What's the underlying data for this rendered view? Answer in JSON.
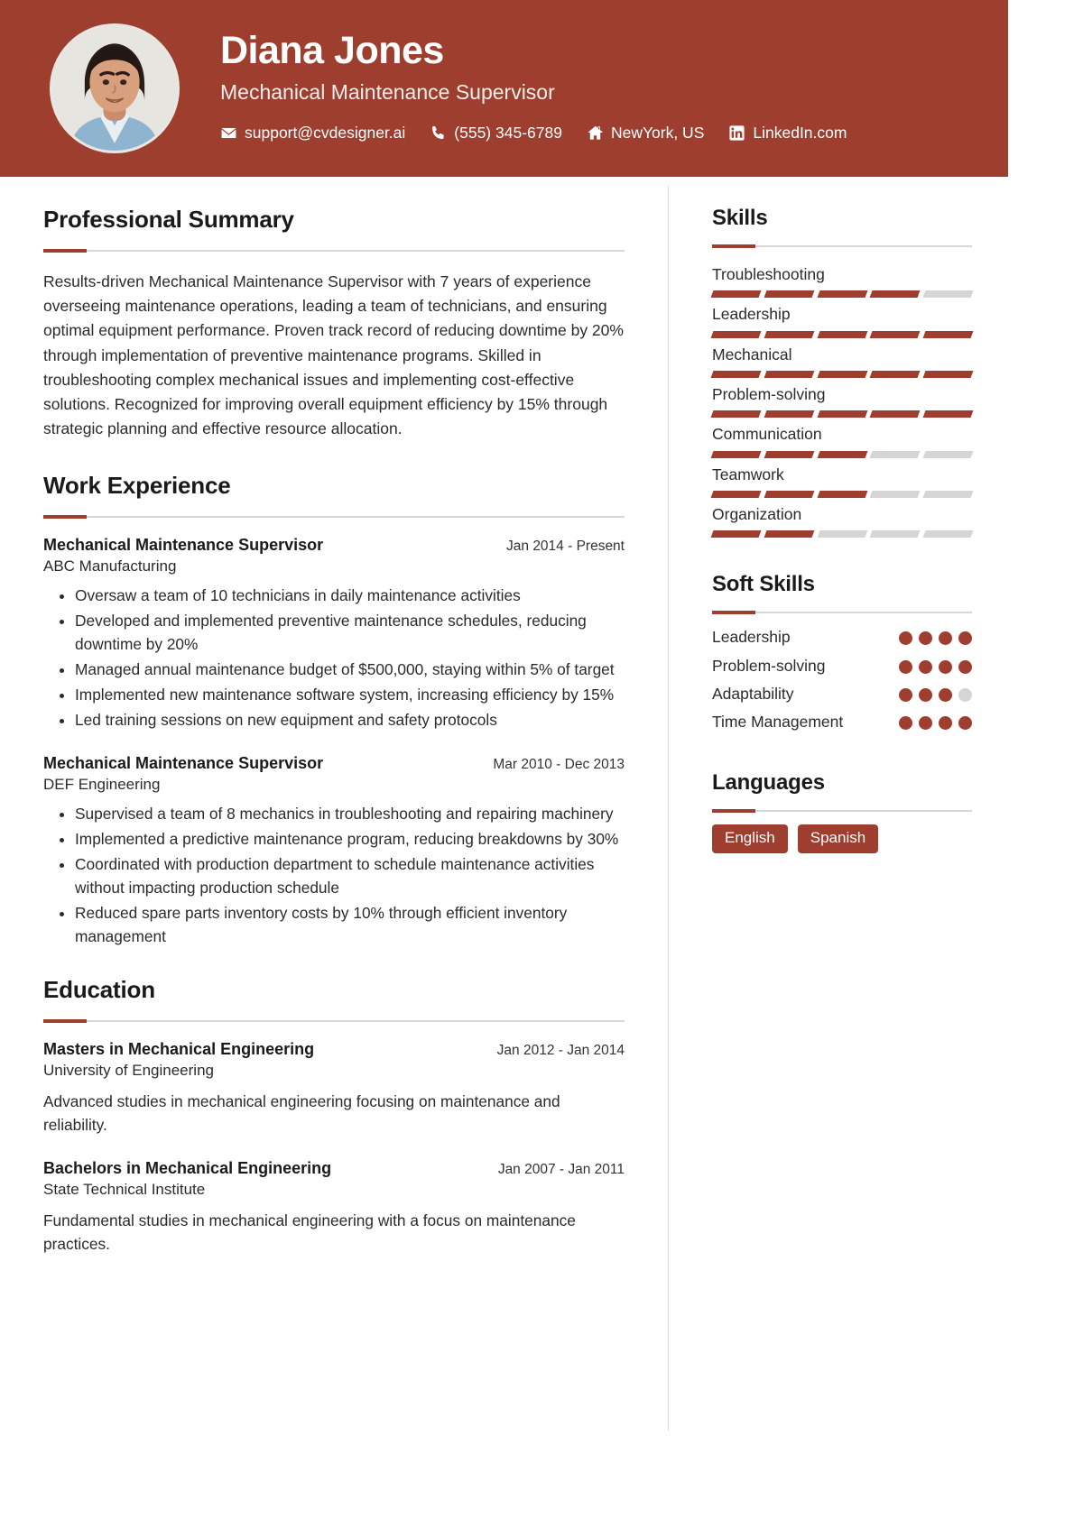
{
  "theme": {
    "accent": "#9E3E2F",
    "track": "#d5d5d5",
    "rule": "#d7d7d7",
    "text": "#2b2b2b"
  },
  "header": {
    "name": "Diana Jones",
    "job_title": "Mechanical Maintenance Supervisor",
    "avatar_alt": "profile-photo",
    "contacts": [
      {
        "icon": "envelope-icon",
        "text": "support@cvdesigner.ai"
      },
      {
        "icon": "phone-icon",
        "text": "(555) 345-6789"
      },
      {
        "icon": "home-icon",
        "text": "NewYork, US"
      },
      {
        "icon": "linkedin-icon",
        "text": "LinkedIn.com"
      }
    ]
  },
  "main": {
    "summary": {
      "title": "Professional Summary",
      "text": "Results-driven Mechanical Maintenance Supervisor with 7 years of experience overseeing maintenance operations, leading a team of technicians, and ensuring optimal equipment performance. Proven track record of reducing downtime by 20% through implementation of preventive maintenance programs. Skilled in troubleshooting complex mechanical issues and implementing cost-effective solutions. Recognized for improving overall equipment efficiency by 15% through strategic planning and effective resource allocation."
    },
    "experience": {
      "title": "Work Experience",
      "entries": [
        {
          "role": "Mechanical Maintenance Supervisor",
          "date": "Jan 2014 - Present",
          "org": "ABC Manufacturing",
          "bullets": [
            "Oversaw a team of 10 technicians in daily maintenance activities",
            "Developed and implemented preventive maintenance schedules, reducing downtime by 20%",
            "Managed annual maintenance budget of $500,000, staying within 5% of target",
            "Implemented new maintenance software system, increasing efficiency by 15%",
            "Led training sessions on new equipment and safety protocols"
          ]
        },
        {
          "role": "Mechanical Maintenance Supervisor",
          "date": "Mar 2010 - Dec 2013",
          "org": "DEF Engineering",
          "bullets": [
            "Supervised a team of 8 mechanics in troubleshooting and repairing machinery",
            "Implemented a predictive maintenance program, reducing breakdowns by 30%",
            "Coordinated with production department to schedule maintenance activities without impacting production schedule",
            "Reduced spare parts inventory costs by 10% through efficient inventory management"
          ]
        }
      ]
    },
    "education": {
      "title": "Education",
      "entries": [
        {
          "degree": "Masters in Mechanical Engineering",
          "date": "Jan 2012 - Jan 2014",
          "school": "University of Engineering",
          "description": "Advanced studies in mechanical engineering focusing on maintenance and reliability."
        },
        {
          "degree": "Bachelors in Mechanical Engineering",
          "date": "Jan 2007 - Jan 2011",
          "school": "State Technical Institute",
          "description": "Fundamental studies in mechanical engineering with a focus on maintenance practices."
        }
      ]
    }
  },
  "sidebar": {
    "skills": {
      "title": "Skills",
      "segments_total": 5,
      "items": [
        {
          "name": "Troubleshooting",
          "filled": 4
        },
        {
          "name": "Leadership",
          "filled": 5
        },
        {
          "name": "Mechanical",
          "filled": 5
        },
        {
          "name": "Problem-solving",
          "filled": 5
        },
        {
          "name": "Communication",
          "filled": 3
        },
        {
          "name": "Teamwork",
          "filled": 3
        },
        {
          "name": "Organization",
          "filled": 2
        }
      ]
    },
    "soft_skills": {
      "title": "Soft Skills",
      "dots_total": 4,
      "items": [
        {
          "name": "Leadership",
          "filled": 4
        },
        {
          "name": "Problem-solving",
          "filled": 4
        },
        {
          "name": "Adaptability",
          "filled": 3
        },
        {
          "name": "Time Management",
          "filled": 4
        }
      ]
    },
    "languages": {
      "title": "Languages",
      "items": [
        "English",
        "Spanish"
      ]
    }
  }
}
